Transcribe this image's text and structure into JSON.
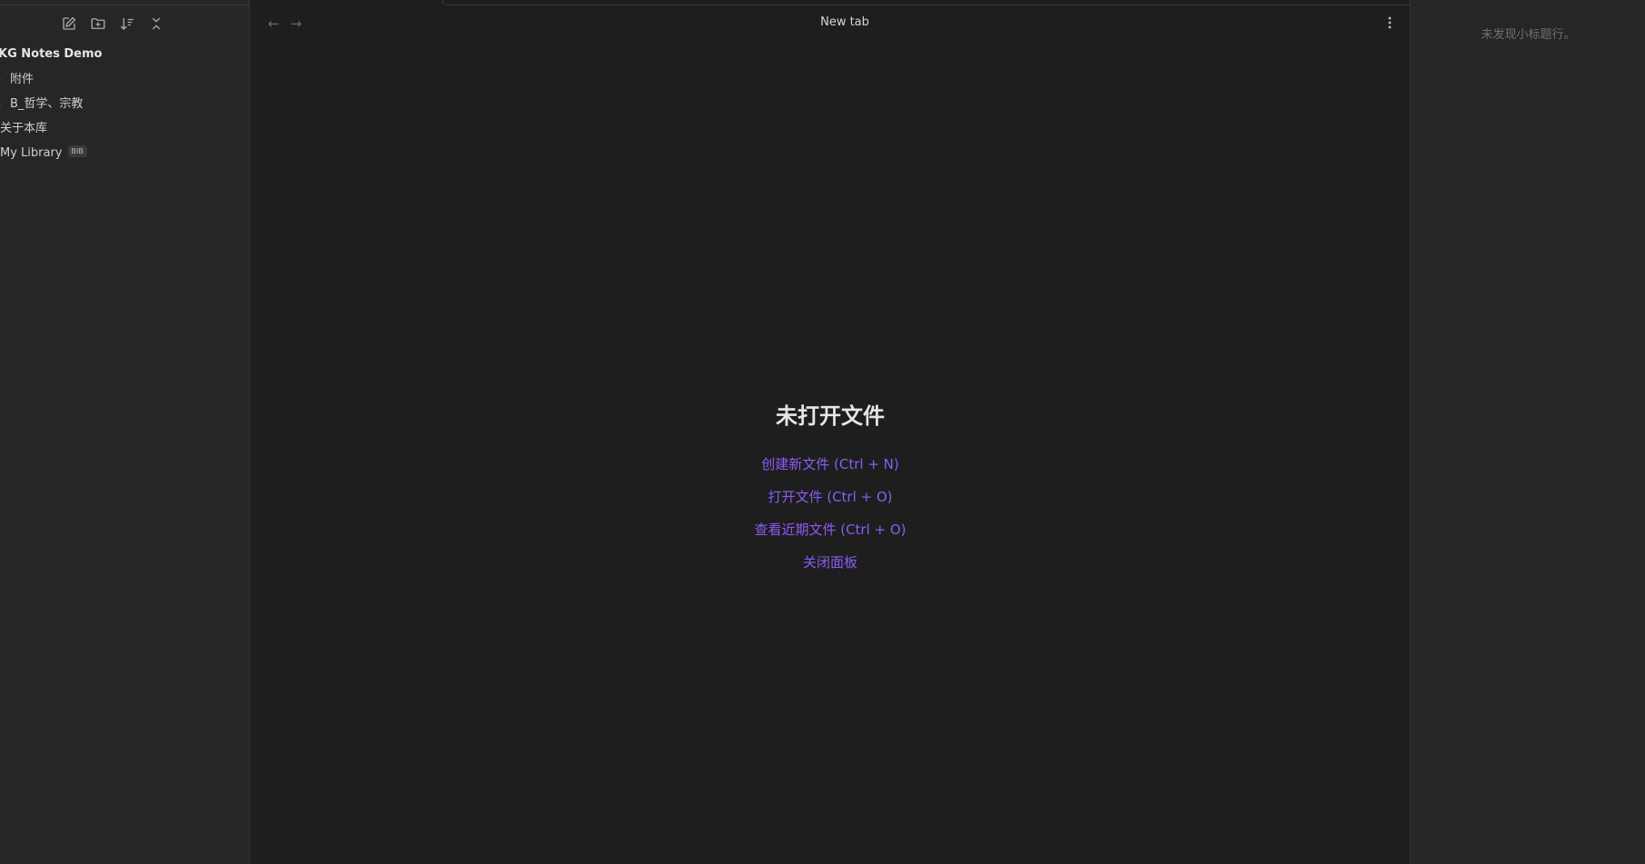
{
  "sidebar": {
    "actions": [
      {
        "name": "new-note",
        "icon": "edit-icon"
      },
      {
        "name": "new-folder",
        "icon": "folder-plus-icon"
      },
      {
        "name": "sort",
        "icon": "sort-icon"
      },
      {
        "name": "collapse-all",
        "icon": "collapse-icon"
      }
    ],
    "vault_name": "KG Notes Demo",
    "items": [
      {
        "label": "附件",
        "type": "folder"
      },
      {
        "label": "B_哲学、宗教",
        "type": "folder"
      },
      {
        "label": "关于本库",
        "type": "file"
      },
      {
        "label": "My Library",
        "type": "file",
        "badge": "BIB"
      }
    ]
  },
  "main": {
    "tab_title": "New tab",
    "back_icon": "arrow-left-icon",
    "forward_icon": "arrow-right-icon",
    "more_icon": "more-vertical-icon",
    "empty_state": {
      "title": "未打开文件",
      "links": [
        "创建新文件 (Ctrl + N)",
        "打开文件 (Ctrl + O)",
        "查看近期文件 (Ctrl + O)",
        "关闭面板"
      ]
    }
  },
  "right_panel": {
    "outline_empty": "未发现小标题行。"
  },
  "colors": {
    "accent": "#8a5cf5",
    "background": "#1e1e1e",
    "sidebar": "#262626"
  }
}
